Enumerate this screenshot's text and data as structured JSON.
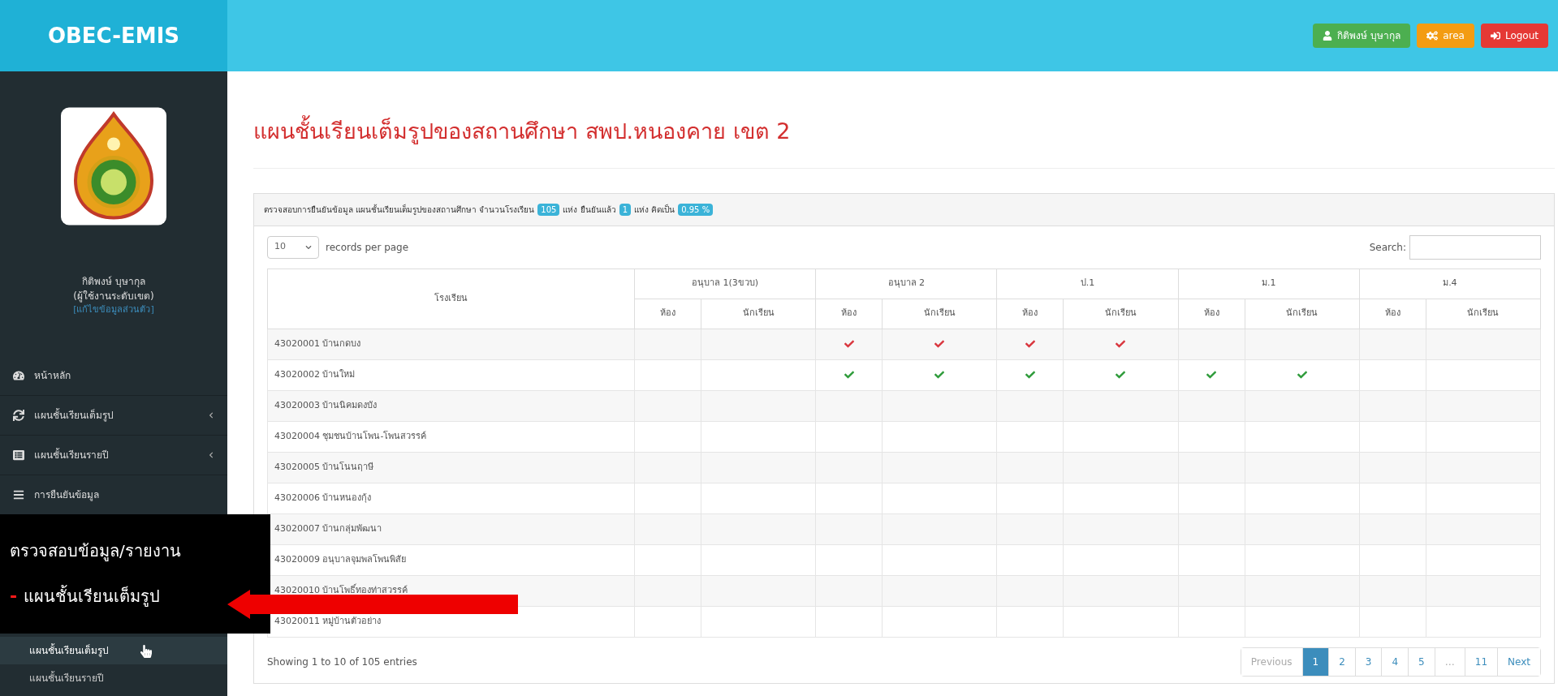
{
  "brand": "OBEC-EMIS",
  "top_buttons": [
    {
      "kind": "user",
      "label": "กิติพงษ์ บุษากุล"
    },
    {
      "kind": "area",
      "label": "area"
    },
    {
      "kind": "logout",
      "label": "Logout"
    }
  ],
  "sidebar": {
    "user_name": "กิติพงษ์ บุษากุล",
    "user_role": "(ผู้ใช้งานระดับเขต)",
    "edit_link": "[แก้ไขข้อมูลส่วนตัว]",
    "items": [
      {
        "kind": "home",
        "label": "หน้าหลัก",
        "expandable": false
      },
      {
        "kind": "sync",
        "label": "แผนชั้นเรียนเต็มรูป",
        "expandable": true
      },
      {
        "kind": "table",
        "label": "แผนชั้นเรียนรายปี",
        "expandable": true
      },
      {
        "kind": "list",
        "label": "การยืนยันข้อมูล",
        "expandable": false
      }
    ],
    "sub_items": [
      {
        "label": "แผนชั้นเรียนเต็มรูป",
        "hovered": true
      },
      {
        "label": "แผนชั้นเรียนรายปี",
        "hovered": false
      }
    ]
  },
  "page_title": "แผนชั้นเรียนเต็มรูปของสถานศึกษา สพป.หนองคาย เขต 2",
  "summary": [
    {
      "kind": "text",
      "text": "ตรวจสอบการยืนยันข้อมูล แผนชั้นเรียนเต็มรูปของสถานศึกษา จำนวนโรงเรียน"
    },
    {
      "kind": "badge",
      "text": "105"
    },
    {
      "kind": "text",
      "text": "แห่ง ยืนยันแล้ว"
    },
    {
      "kind": "badge",
      "text": "1"
    },
    {
      "kind": "text",
      "text": "แห่ง คิดเป็น"
    },
    {
      "kind": "badge",
      "text": "0.95 %"
    }
  ],
  "page_size": "10",
  "page_size_label": "records per page",
  "search_label": "Search:",
  "table": {
    "school_column": "โรงเรียน",
    "groups": [
      {
        "label": "อนุบาล 1(3ขวบ)",
        "sub": [
          "ห้อง",
          "นักเรียน"
        ]
      },
      {
        "label": "อนุบาล 2",
        "sub": [
          "ห้อง",
          "นักเรียน"
        ]
      },
      {
        "label": "ป.1",
        "sub": [
          "ห้อง",
          "นักเรียน"
        ]
      },
      {
        "label": "ม.1",
        "sub": [
          "ห้อง",
          "นักเรียน"
        ]
      },
      {
        "label": "ม.4",
        "sub": [
          "ห้อง",
          "นักเรียน"
        ]
      }
    ],
    "rows": [
      {
        "school": "43020001 บ้านกดบง",
        "cells": [
          {
            "checked": false
          },
          {
            "checked": false
          },
          {
            "checked": true,
            "color": "#d9363e"
          },
          {
            "checked": true,
            "color": "#d9363e"
          },
          {
            "checked": true,
            "color": "#d9363e"
          },
          {
            "checked": true,
            "color": "#d9363e"
          },
          {
            "checked": false
          },
          {
            "checked": false
          },
          {
            "checked": false
          },
          {
            "checked": false
          }
        ]
      },
      {
        "school": "43020002 บ้านใหม่",
        "cells": [
          {
            "checked": false
          },
          {
            "checked": false
          },
          {
            "checked": true,
            "color": "#2e9b3a"
          },
          {
            "checked": true,
            "color": "#2e9b3a"
          },
          {
            "checked": true,
            "color": "#2e9b3a"
          },
          {
            "checked": true,
            "color": "#2e9b3a"
          },
          {
            "checked": true,
            "color": "#2e9b3a"
          },
          {
            "checked": true,
            "color": "#2e9b3a"
          },
          {
            "checked": false
          },
          {
            "checked": false
          }
        ]
      },
      {
        "school": "43020003 บ้านนิคมดงบัง",
        "cells": []
      },
      {
        "school": "43020004 ชุมชนบ้านโพน-โพนสวรรค์",
        "cells": []
      },
      {
        "school": "43020005 บ้านโนนฤาษี",
        "cells": []
      },
      {
        "school": "43020006 บ้านหนองกุ้ง",
        "cells": []
      },
      {
        "school": "43020007 บ้านกลุ่มพัฒนา",
        "cells": []
      },
      {
        "school": "43020009 อนุบาลจุมพลโพนพิสัย",
        "cells": []
      },
      {
        "school": "43020010 บ้านโพธิ์ทองท่าสวรรค์",
        "cells": []
      },
      {
        "school": "43020011 หมู่บ้านตัวอย่าง",
        "cells": []
      }
    ]
  },
  "info": "Showing 1 to 10 of 105 entries",
  "pagination": [
    {
      "label": "Previous",
      "selected": false,
      "disabled": true
    },
    {
      "label": "1",
      "selected": true,
      "disabled": false
    },
    {
      "label": "2",
      "selected": false,
      "disabled": false
    },
    {
      "label": "3",
      "selected": false,
      "disabled": false
    },
    {
      "label": "4",
      "selected": false,
      "disabled": false
    },
    {
      "label": "5",
      "selected": false,
      "disabled": false
    },
    {
      "label": "…",
      "selected": false,
      "disabled": true
    },
    {
      "label": "11",
      "selected": false,
      "disabled": false
    },
    {
      "label": "Next",
      "selected": false,
      "disabled": false
    }
  ],
  "callout": {
    "heading": "ตรวจสอบข้อมูล/รายงาน",
    "bullet": "-",
    "item": "แผนชั้นเรียนเต็มรูป"
  }
}
